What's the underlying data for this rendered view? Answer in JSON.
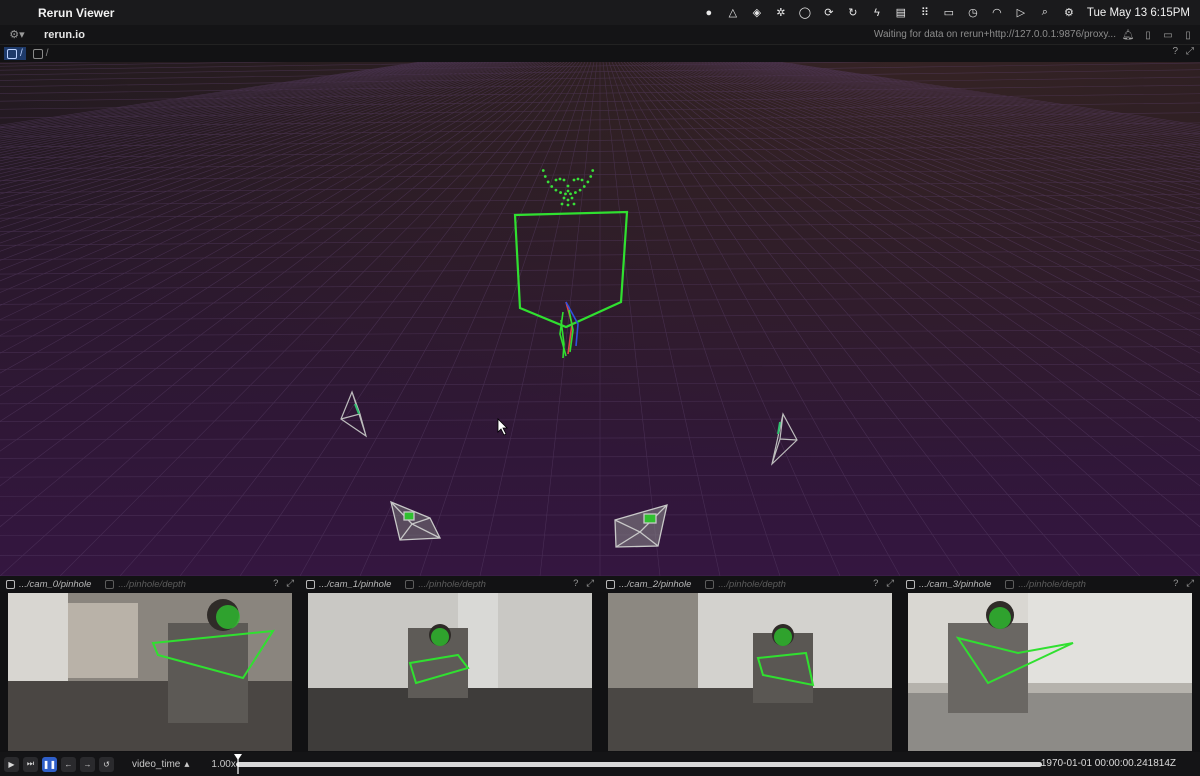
{
  "menubar": {
    "app_name": "Rerun Viewer",
    "clock": "Tue May 13  6:15PM",
    "tray_icons": [
      "record-icon",
      "warp-icon",
      "vpn-icon",
      "openai-icon",
      "circle-icon",
      "refresh-icon",
      "sync-icon",
      "flash-icon",
      "clipboard-icon",
      "grid-icon",
      "battery-icon",
      "history-icon",
      "wifi-icon",
      "play-icon",
      "search-icon",
      "control-center-icon"
    ]
  },
  "appbar": {
    "brand": "rerun.io",
    "status": "Waiting for data on rerun+http://127.0.0.1:9876/proxy..."
  },
  "viewport": {
    "tab_active": "/",
    "tab_other": "/",
    "help": "?"
  },
  "cameras": [
    {
      "name": ".../cam_0/pinhole",
      "depth": ".../pinhole/depth"
    },
    {
      "name": ".../cam_1/pinhole",
      "depth": ".../pinhole/depth"
    },
    {
      "name": ".../cam_2/pinhole",
      "depth": ".../pinhole/depth"
    },
    {
      "name": ".../cam_3/pinhole",
      "depth": ".../pinhole/depth"
    }
  ],
  "timeline": {
    "timeline_name": "video_time",
    "speed": "1.00x",
    "current_time": "1970-01-01 00:00:00.241814Z",
    "progress": 0.0
  },
  "colors": {
    "accent_blue": "#2f5fc9",
    "skeleton_green": "#2fe02f",
    "grid_purple": "#3a1c50"
  }
}
